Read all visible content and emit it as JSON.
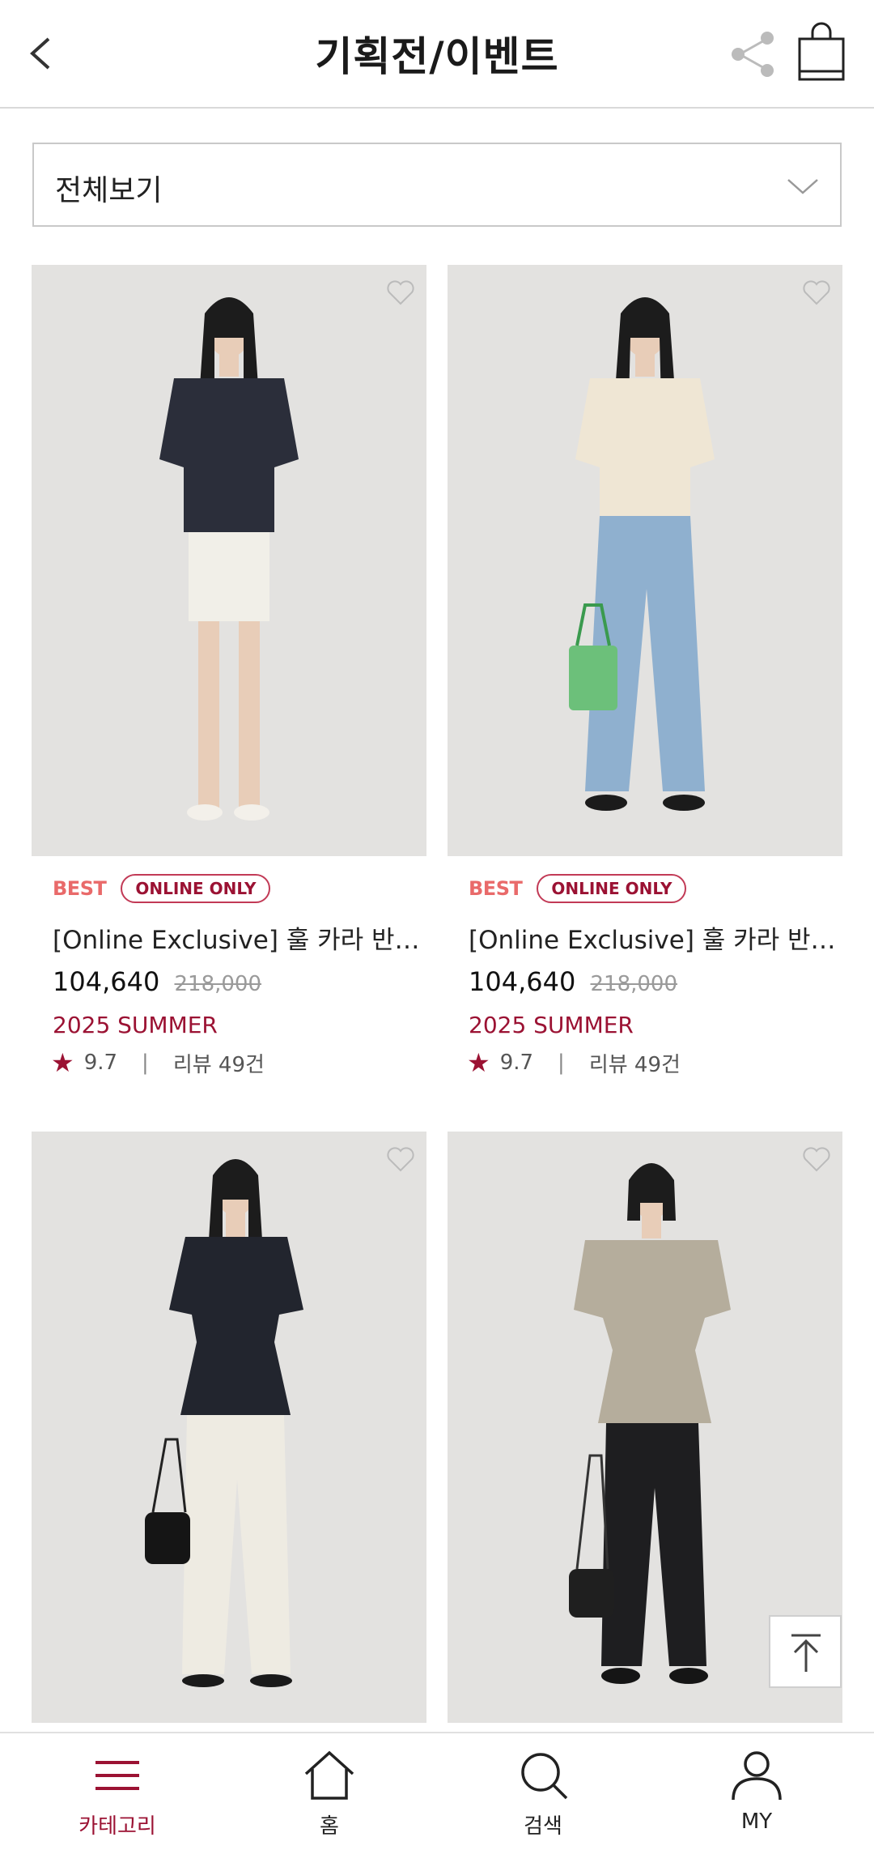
{
  "header": {
    "title": "기획전/이벤트"
  },
  "filter": {
    "selected": "전체보기"
  },
  "products": [
    {
      "best": "BEST",
      "online": "ONLINE ONLY",
      "name": "[Online Exclusive] 훌 카라 반…",
      "price": "104,640",
      "original_price": "218,000",
      "season": "2025 SUMMER",
      "rating": "9.7",
      "reviews": "리뷰 49건",
      "top_color": "#2b2e3a",
      "bottom_color": "#f1efe8"
    },
    {
      "best": "BEST",
      "online": "ONLINE ONLY",
      "name": "[Online Exclusive] 훌 카라 반…",
      "price": "104,640",
      "original_price": "218,000",
      "season": "2025 SUMMER",
      "rating": "9.7",
      "reviews": "리뷰 49건",
      "top_color": "#efe6d4",
      "bottom_color": "#8fb0cf"
    },
    {
      "top_color": "#22252e",
      "bottom_color": "#eeebe2"
    },
    {
      "top_color": "#b5ad9c",
      "bottom_color": "#1e1e20"
    }
  ],
  "tabbar": {
    "items": [
      {
        "label": "카테고리",
        "icon": "menu-icon",
        "active": true
      },
      {
        "label": "홈",
        "icon": "home-icon",
        "active": false
      },
      {
        "label": "검색",
        "icon": "search-icon",
        "active": false
      },
      {
        "label": "MY",
        "icon": "user-icon",
        "active": false
      }
    ]
  },
  "colors": {
    "accent": "#9b1233",
    "best": "#e96a6a",
    "image_bg": "#e3e2e0"
  }
}
